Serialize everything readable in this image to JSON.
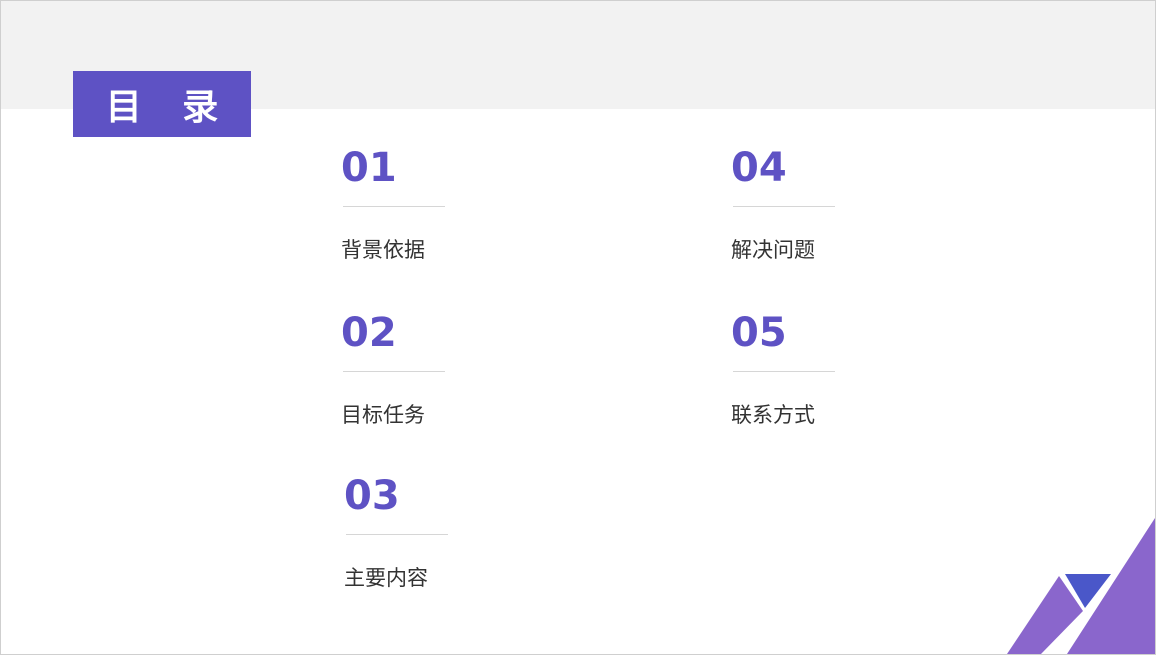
{
  "title": "目 录",
  "items": [
    {
      "number": "01",
      "label": "背景依据"
    },
    {
      "number": "02",
      "label": "目标任务"
    },
    {
      "number": "03",
      "label": "主要内容"
    },
    {
      "number": "04",
      "label": "解决问题"
    },
    {
      "number": "05",
      "label": "联系方式"
    }
  ],
  "colors": {
    "accent": "#5e52c4",
    "decor_light": "#8a66cc",
    "decor_blue": "#4a57c9",
    "band": "#f2f2f2"
  }
}
